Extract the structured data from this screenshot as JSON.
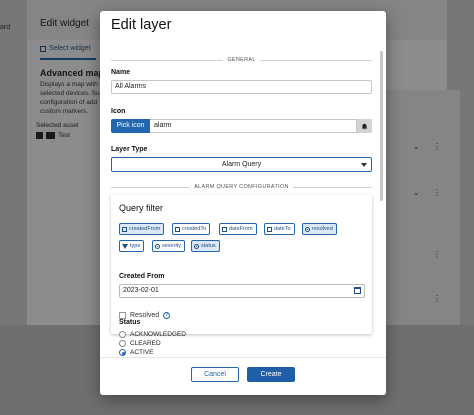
{
  "background": {
    "left_cut_text": "ard",
    "title": "Edit widget",
    "tab_label": "Select widget",
    "card_title": "Advanced map w",
    "description_lines": [
      "Displays a map with",
      "selected devices. Su",
      "configuration of add",
      "custom markers."
    ],
    "selected_asset_label": "Selected asset",
    "asset_name": "Test"
  },
  "dialog": {
    "title": "Edit layer",
    "general_section": "GENERAL",
    "name_label": "Name",
    "name_value": "All Alarms",
    "icon_label": "Icon",
    "pick_icon_button": "Pick icon",
    "icon_value": "alarm",
    "layer_type_label": "Layer Type",
    "layer_type_value": "Alarm Query",
    "alarm_query_section": "ALARM QUERY CONFIGURATION",
    "query_filter": {
      "title": "Query filter",
      "chips": [
        {
          "label": "createdFrom",
          "active": true,
          "icon": "calendar-icon"
        },
        {
          "label": "createdTo",
          "active": false,
          "icon": "calendar-icon"
        },
        {
          "label": "dateFrom",
          "active": false,
          "icon": "calendar-icon"
        },
        {
          "label": "dateTo",
          "active": false,
          "icon": "calendar-icon"
        },
        {
          "label": "resolved",
          "active": true,
          "icon": "radio-icon"
        },
        {
          "label": "type",
          "active": false,
          "icon": "filter-icon"
        },
        {
          "label": "severity",
          "active": false,
          "icon": "radio-icon"
        },
        {
          "label": "status",
          "active": true,
          "icon": "radio-icon"
        }
      ],
      "created_from_label": "Created From",
      "created_from_value": "2023-02-01",
      "resolved_label": "Resolved",
      "help_glyph": "?"
    },
    "status": {
      "label": "Status",
      "options": [
        "ACKNOWLEDGED",
        "CLEARED",
        "ACTIVE"
      ],
      "selected": "ACTIVE"
    },
    "footer": {
      "cancel_label": "Cancel",
      "create_label": "Create"
    }
  },
  "colors": {
    "primary": "#2266b0",
    "overlay": "#777777"
  }
}
